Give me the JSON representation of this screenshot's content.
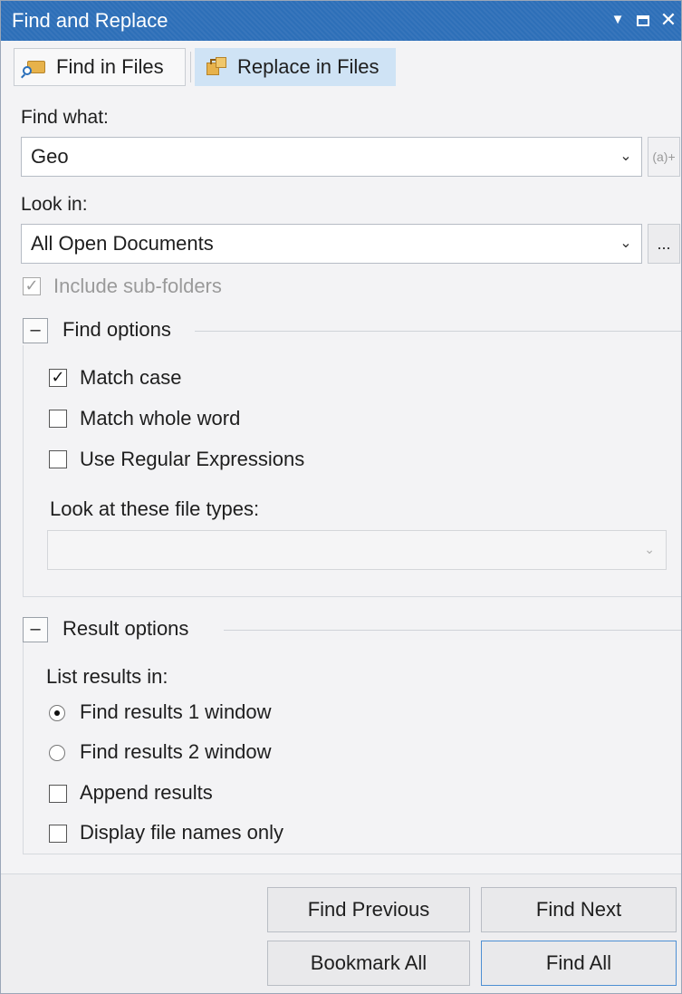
{
  "window": {
    "title": "Find and Replace"
  },
  "toolbar": {
    "find_in_files": "Find in Files",
    "replace_in_files": "Replace in Files"
  },
  "find_what": {
    "label": "Find what:",
    "value": "Geo",
    "side_button": "(a)+"
  },
  "look_in": {
    "label": "Look in:",
    "value": "All Open Documents",
    "browse": "..."
  },
  "include_subfolders": {
    "label": "Include sub-folders",
    "checked": true,
    "enabled": false
  },
  "find_options": {
    "title": "Find options",
    "collapse_glyph": "–",
    "match_case": {
      "label": "Match case",
      "checked": true
    },
    "match_whole_word": {
      "label": "Match whole word",
      "checked": false
    },
    "use_regex": {
      "label": "Use Regular Expressions",
      "checked": false
    },
    "file_types_label": "Look at these file types:",
    "file_types_value": ""
  },
  "result_options": {
    "title": "Result options",
    "collapse_glyph": "–",
    "list_results_in": "List results in:",
    "window1": {
      "label": "Find results 1 window",
      "selected": true
    },
    "window2": {
      "label": "Find results 2 window",
      "selected": false
    },
    "append": {
      "label": "Append results",
      "checked": false
    },
    "file_names_only": {
      "label": "Display file names only",
      "checked": false
    }
  },
  "buttons": {
    "find_previous": "Find Previous",
    "find_next": "Find Next",
    "bookmark_all": "Bookmark All",
    "find_all": "Find All"
  },
  "glyphs": {
    "dropdown": "▼",
    "close": "✕",
    "combo_arrow": "⌄",
    "check": "✓"
  }
}
